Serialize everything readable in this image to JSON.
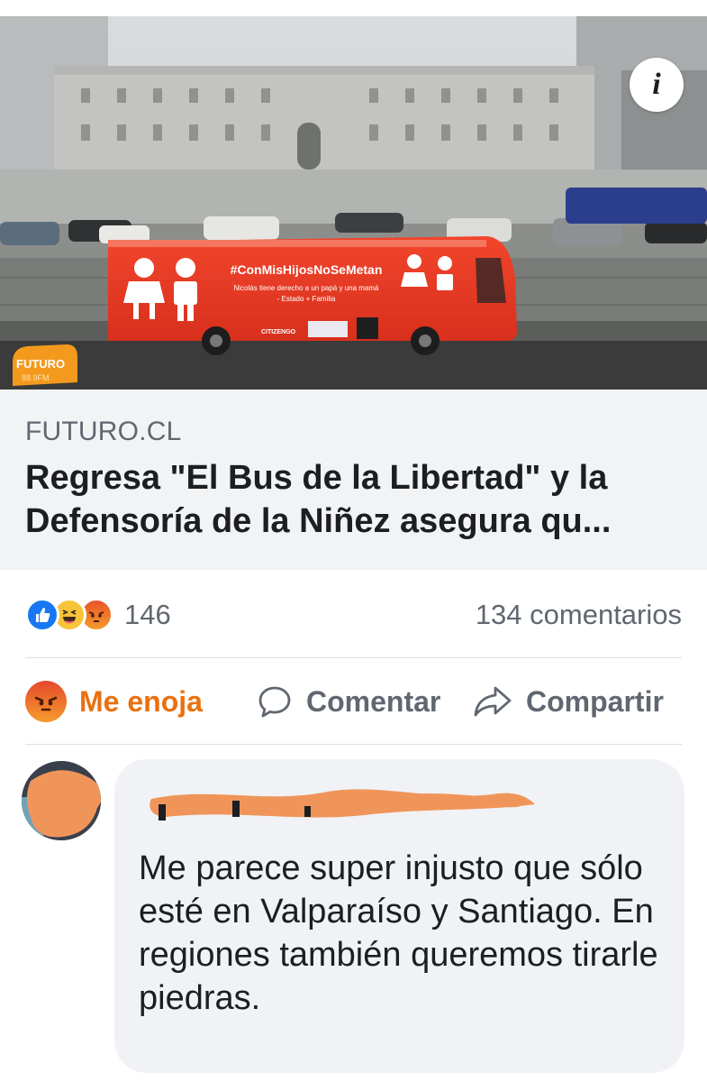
{
  "colors": {
    "angry_orange": "#e9710f",
    "facebook_blue": "#1877f2",
    "text_primary": "#1c1e21",
    "text_secondary": "#606770",
    "caption_bg": "#f2f3f5",
    "bubble_bg": "#f0f2f5",
    "scribble_orange": "#f0955a"
  },
  "link_preview": {
    "info_icon": "info-icon",
    "image": {
      "bus_hashtag": "#ConMisHijosNoSeMetan",
      "bus_slogan_line1": "Nicolás tiene derecho a un papá y una mamá",
      "bus_slogan_line2": "- Estado + Familia",
      "bus_logo": "CITIZENGO",
      "watermark_line1": "FUTURO",
      "watermark_line2": "88.9FM"
    },
    "domain": "FUTURO.CL",
    "title": "Regresa \"El Bus de la Libertad\" y la Defensoría de la Niñez asegura qu..."
  },
  "reactions": {
    "icons": [
      "like-icon",
      "haha-icon",
      "angry-icon"
    ],
    "count": "146",
    "comments": "134 comentarios"
  },
  "actions": {
    "react_label": "Me enoja",
    "comment_label": "Comentar",
    "share_label": "Compartir"
  },
  "comment": {
    "text": "Me parece super injusto que sólo esté en Valparaíso y Santiago. En regiones también queremos tirarle piedras."
  }
}
